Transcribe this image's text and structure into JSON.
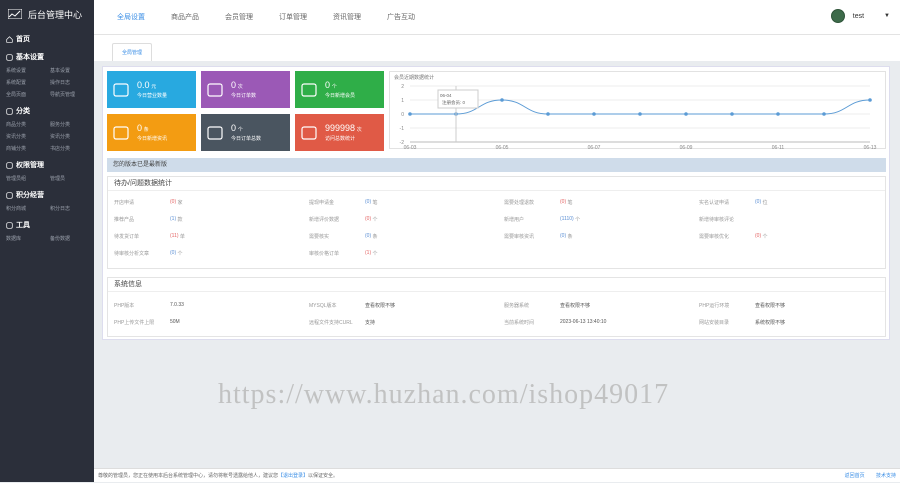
{
  "app_title": "后台管理中心",
  "sidebar": {
    "home": "首页",
    "sections": [
      {
        "title": "基本设置",
        "items": [
          [
            "系统设置",
            "基本设置"
          ],
          [
            "系统配置",
            "操作日志"
          ],
          [
            "全局页面",
            "导航页管理"
          ]
        ]
      },
      {
        "title": "分类",
        "items": [
          [
            "商品分类",
            "服务分类"
          ],
          [
            "资讯分类",
            "资讯分类"
          ],
          [
            "商铺分类",
            "书店分类"
          ]
        ]
      },
      {
        "title": "权限管理",
        "items": [
          [
            "管理员组",
            "管理员"
          ]
        ]
      },
      {
        "title": "积分经营",
        "items": [
          [
            "积分商城",
            "积分日志"
          ]
        ]
      },
      {
        "title": "工具",
        "items": [
          [
            "数据库",
            "备份数据"
          ]
        ]
      }
    ]
  },
  "topnav": [
    "全局设置",
    "商品产品",
    "会员管理",
    "订单管理",
    "资讯管理",
    "广告互动"
  ],
  "user": {
    "name": "test"
  },
  "subtab": "全局管理",
  "cards": [
    {
      "num": "0.0",
      "unit": "元",
      "label": "今日营业数量",
      "color": "#28a9e0"
    },
    {
      "num": "0",
      "unit": "次",
      "label": "今日订单数",
      "color": "#9b59b6"
    },
    {
      "num": "0",
      "unit": "个",
      "label": "今日新增会员",
      "color": "#2fae48"
    },
    {
      "num": "0",
      "unit": "条",
      "label": "今日新增资讯",
      "color": "#f39c12"
    },
    {
      "num": "0",
      "unit": "个",
      "label": "今日订单总数",
      "color": "#4a5560"
    },
    {
      "num": "999998",
      "unit": "次",
      "label": "访问总数统计",
      "color": "#e05a46"
    }
  ],
  "chart_data": {
    "type": "line",
    "title": "会员近期数据统计",
    "x": [
      "06-03",
      "06-04",
      "06-05",
      "06-06",
      "06-07",
      "06-08",
      "06-09",
      "06-10",
      "06-11",
      "06-12",
      "06-13"
    ],
    "series": [
      {
        "name": "注册会员",
        "values": [
          0,
          0,
          1,
          0,
          0,
          0,
          0,
          0,
          0,
          0,
          1
        ]
      }
    ],
    "ylim": [
      -2,
      2
    ],
    "yticks": [
      2,
      1,
      0,
      -1,
      -2
    ],
    "xticks": [
      "06-03",
      "06-05",
      "06-07",
      "06-09",
      "06-11",
      "06-13"
    ],
    "tooltip": {
      "title": "06-04",
      "text": "注册会员: 0"
    },
    "grid": true,
    "color": "#5b9bd5"
  },
  "notice_bar": "您的版本已是最新版",
  "stats": {
    "title": "待办/问题数据统计",
    "rows": [
      [
        [
          "开店申请",
          "(0)",
          "家",
          "red"
        ],
        [
          "提现申请金",
          "(0)",
          "笔",
          "blue"
        ],
        [
          "需要处理退款",
          "(0)",
          "笔",
          "red"
        ],
        [
          "实名认证申请",
          "(0)",
          "位",
          "blue"
        ]
      ],
      [
        [
          "推荐产品",
          "(1)",
          "款",
          "blue"
        ],
        [
          "新增评价数据",
          "(0)",
          "个",
          "red"
        ],
        [
          "新增用户",
          "(1110)",
          "个",
          "blue"
        ],
        [
          "新增待审核评论",
          "",
          "",
          ""
        ]
      ],
      [
        [
          "待发货订单",
          "(11)",
          "单",
          "red"
        ],
        [
          "需要核实",
          "(0)",
          "条",
          "blue"
        ],
        [
          "需要审核资讯",
          "(0)",
          "条",
          "blue"
        ],
        [
          "需要审核优化",
          "(0)",
          "个",
          "red"
        ]
      ],
      [
        [
          "待审核分析文章",
          "(0)",
          "个",
          "blue"
        ],
        [
          "审核价格订单",
          "(1)",
          "个",
          "red"
        ]
      ]
    ]
  },
  "sysinfo": {
    "title": "系统信息",
    "rows": [
      [
        [
          "PHP版本",
          "7.0.33"
        ],
        [
          "MYSQL版本",
          "查看权限不够"
        ],
        [
          "服务器系统",
          "查看权限不够"
        ],
        [
          "PHP运行环境",
          "查看权限不够"
        ]
      ],
      [
        [
          "PHP上传文件上限",
          "50M"
        ],
        [
          "远程文件支持CURL",
          "支持"
        ],
        [
          "当前系统时间",
          "2023-06-13 13:40:10"
        ],
        [
          "网站安装目录",
          "系统权限不够"
        ]
      ]
    ]
  },
  "watermark": "https://www.huzhan.com/ishop49017",
  "footer": {
    "text": "尊敬的管理员，您正在使用本后台系统管理中心，请勿将帐号透露给他人，建议您",
    "link": "【退出登录】",
    "tail": "以保证安全。",
    "right": [
      "返回首页",
      "技术支持"
    ]
  }
}
